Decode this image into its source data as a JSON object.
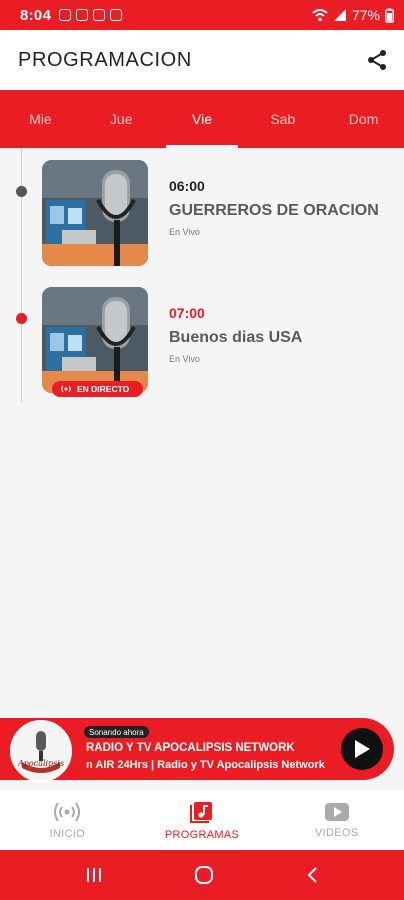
{
  "status_bar": {
    "time": "8:04",
    "battery": "77%"
  },
  "app_bar": {
    "title": "PROGRAMACION",
    "share_icon": "share-icon"
  },
  "tabs": [
    {
      "label": "Mie",
      "active": false
    },
    {
      "label": "Jue",
      "active": false
    },
    {
      "label": "Vie",
      "active": true
    },
    {
      "label": "Sab",
      "active": false
    },
    {
      "label": "Dom",
      "active": false
    }
  ],
  "programs": [
    {
      "time": "06:00",
      "name": "GUERREROS DE ORACION",
      "subtitle": "En Vivo",
      "live": false
    },
    {
      "time": "07:00",
      "name": "Buenos dias USA",
      "subtitle": "En Vivo",
      "live": true,
      "badge": "EN DIRECTO"
    }
  ],
  "player": {
    "now_label": "Sonando ahora",
    "station": "RADIO Y TV APOCALIPSIS NETWORK",
    "ticker": "n AIR 24Hrs | Radio y TV Apocalipsis Network",
    "logo_text": "Apocalipsis"
  },
  "bottom_nav": [
    {
      "label": "INICIO",
      "icon": "radio-waves-icon",
      "active": false
    },
    {
      "label": "PROGRAMAS",
      "icon": "music-note-icon",
      "active": true
    },
    {
      "label": "VIDEOS",
      "icon": "video-play-icon",
      "active": false
    }
  ],
  "colors": {
    "accent": "#ea1c24",
    "dark": "#222222"
  }
}
